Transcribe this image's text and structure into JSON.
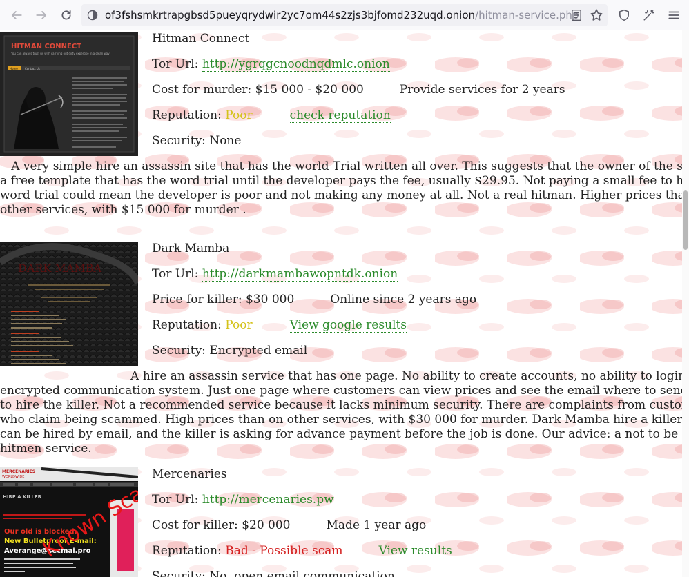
{
  "browser": {
    "url_host": "of3fshsmkrtrapgbsd5pueyqrydwir2yc7om44s2zjs3bjfomd232uqd.onion",
    "url_path": "/hitman-service.php"
  },
  "entries": [
    {
      "name": "Hitman Connect",
      "tor_label": "Tor Url:",
      "tor_url": "http://ygrqgcnoodnqdmlc.onion",
      "cost_label": "Cost for murder:",
      "cost_value": "$15 000 - $20 000",
      "since": "Provide services for 2 years",
      "rep_label": "Reputation:",
      "rep_value": "Poor",
      "rep_link": "check reputation",
      "security_label": "Security:",
      "security_value": "None",
      "desc_lines": [
        "   A very simple hire an assassin site that has the world Trial written all over. This suggests that the owner of the site use",
        "a free template that has the word trial until the developer pays the fee, usually $29.95. Not paying a small fee to have the",
        "word trial could mean the developer is poor and not making any money at all. Not a real hitman. Higher prices than on",
        "other services, with $15 000 for murder ."
      ],
      "img": {
        "title": "HITMAN CONNECT",
        "tagline": "You can always trust us with carrying out dirty expertise in a clean way",
        "nav1": "Home",
        "nav2": "Contact Us"
      }
    },
    {
      "name": "Dark Mamba",
      "tor_label": "Tor Url:",
      "tor_url": "http://darkmambawopntdk.onion",
      "cost_label": "Price for killer:",
      "cost_value": "$30 000",
      "since": "Online since 2 years ago",
      "rep_label": "Reputation:",
      "rep_value": "Poor",
      "rep_link": "View google results",
      "security_label": "Security:",
      "security_value": "Encrypted email",
      "desc_lines": [
        "                                   A hire an assassin service that has one page. No ability to create accounts, no ability to login, n",
        "encrypted communication system. Just one page where customers can view prices and see the email where to send orders",
        "to hire the killer. Not a recommended service because it lacks minimum security. There are complaints from customers",
        "who claim being scammed. High prices than on other services, with $30 000 for murder. Dark Mamba hire a killer service",
        "can be hired by email, and the killer is asking for advance payment before the job is done. Our advice: a not to be used",
        "hitmen service."
      ],
      "img": {
        "title": "DARK MAMBA"
      }
    },
    {
      "name": "Mercenaries",
      "tor_label": "Tor Url:",
      "tor_url": "http://mercenaries.pw",
      "cost_label": "Cost for killer:",
      "cost_value": "$20 000",
      "since": "Made 1 year ago",
      "rep_label": "Reputation:",
      "rep_value": "Bad - Possible scam",
      "rep_link": "View results",
      "security_label": "Security:",
      "security_value": "No, open email communication",
      "img": {
        "title": "MERCENARIES",
        "title2": "WORLDWIDE",
        "hire": "HIRE A KILLER",
        "blocked": "Our old            is blocked.",
        "new_email": "New Bulletproof E-mail:",
        "email": "Averange@secmai.pro",
        "stamp": "Known Scam"
      }
    }
  ],
  "colors": {
    "link": "#2a8a2a",
    "poor": "#d4c21a",
    "bad": "#d42020"
  }
}
